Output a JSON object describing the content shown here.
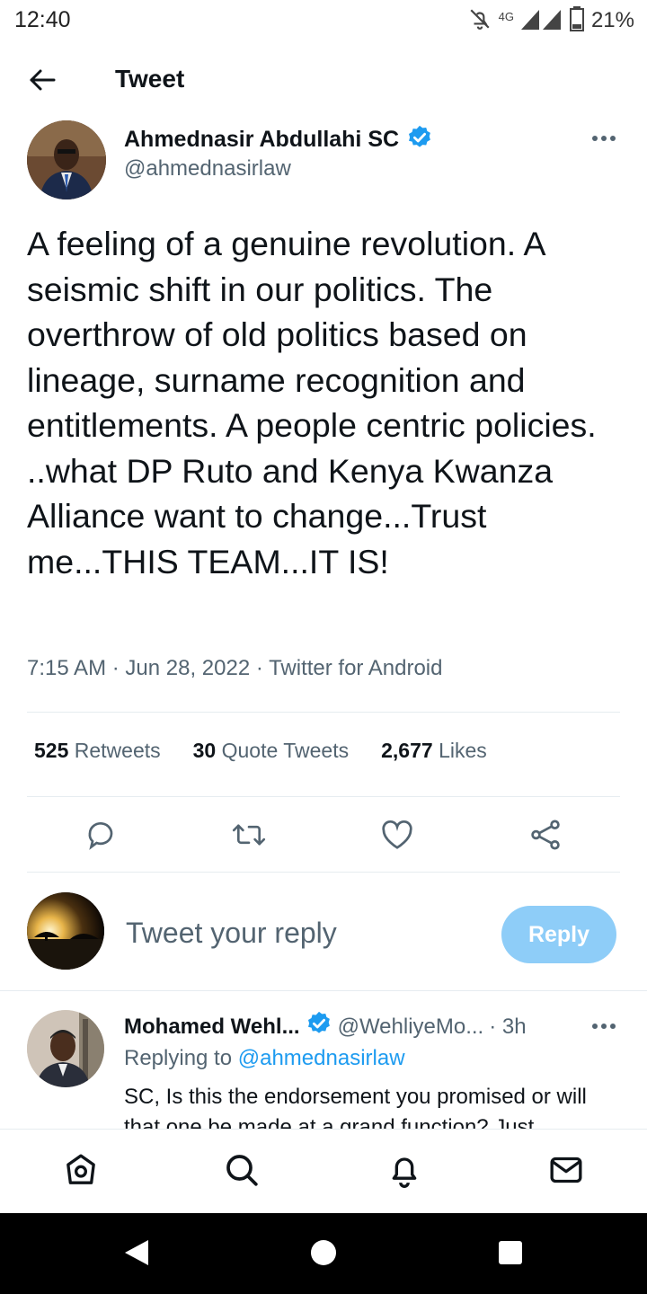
{
  "status_bar": {
    "time": "12:40",
    "network": "4G",
    "battery": "21%"
  },
  "header": {
    "title": "Tweet"
  },
  "tweet": {
    "author_name": "Ahmednasir Abdullahi SC",
    "author_handle": "@ahmednasirlaw",
    "verified": true,
    "text": "A feeling of a genuine revolution. A seismic shift in our politics. The overthrow of old politics based on lineage, surname recognition and entitlements. A people centric policies. ..what DP Ruto and Kenya Kwanza Alliance want to change...Trust me...THIS TEAM...IT IS!",
    "meta": "7:15 AM · Jun 28, 2022 · Twitter for Android",
    "stats": {
      "retweets_count": "525",
      "retweets_label": "Retweets",
      "quotes_count": "30",
      "quotes_label": "Quote Tweets",
      "likes_count": "2,677",
      "likes_label": "Likes"
    }
  },
  "composer": {
    "placeholder": "Tweet your reply",
    "button_label": "Reply"
  },
  "reply": {
    "name": "Mohamed Wehl...",
    "handle": "@WehliyeMo...",
    "time": "· 3h",
    "replying_prefix": "Replying to",
    "replying_mention": "@ahmednasirlaw",
    "text": "SC, Is this the endorsement you promised or will that one be made at a grand function? Just"
  },
  "colors": {
    "accent": "#1d9bf0",
    "reply_button": "#8ecdf8",
    "secondary_text": "#536471"
  },
  "icons": {
    "header": [
      "back-arrow-icon"
    ],
    "actions": [
      "reply-icon",
      "retweet-icon",
      "like-icon",
      "share-icon"
    ],
    "bottom_nav": [
      "home-icon",
      "search-icon",
      "notifications-icon",
      "messages-icon"
    ]
  }
}
